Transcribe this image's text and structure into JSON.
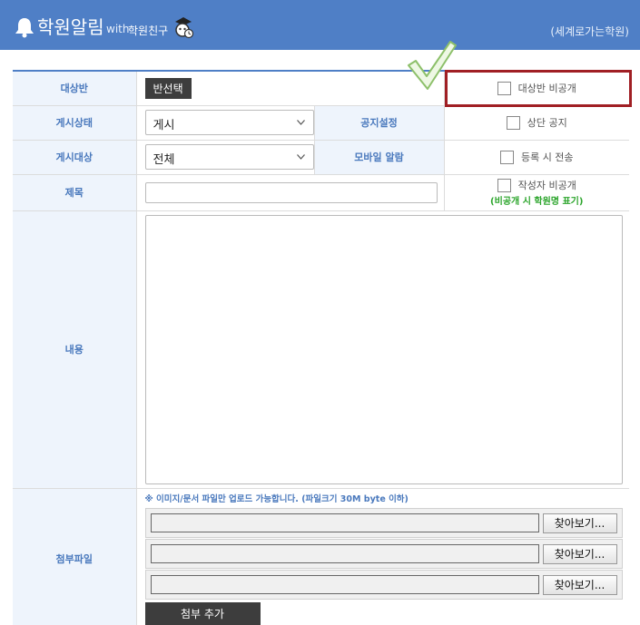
{
  "header": {
    "title": "학원알림",
    "with": "with",
    "friend": "학원친구",
    "academy": "(세계로가는학원)"
  },
  "form": {
    "target_class_label": "대상반",
    "select_class_button": "반선택",
    "hide_class_label": "대상반 비공개",
    "post_status_label": "게시상태",
    "post_status_value": "게시",
    "notice_setting_label": "공지설정",
    "top_notice_label": "상단 공지",
    "post_target_label": "게시대상",
    "post_target_value": "전체",
    "mobile_alarm_label": "모바일 알람",
    "send_on_register_label": "등록 시 전송",
    "subject_label": "제목",
    "hide_author_label": "작성자 비공개",
    "hide_author_note": "(비공개 시 학원명 표기)",
    "content_label": "내용",
    "attachment_label": "첨부파일",
    "upload_notice": "※ 이미지/문서 파일만 업로드 가능합니다. (파일크기 30M byte 이하)",
    "browse_button": "찾아보기...",
    "add_attachment_button": "첨부 추가"
  },
  "colors": {
    "header_bg": "#4f7fc6",
    "label_bg": "#eef4fc",
    "label_text": "#4a79bd",
    "highlight_border": "#a01f24",
    "note_green": "#2ca52c"
  }
}
